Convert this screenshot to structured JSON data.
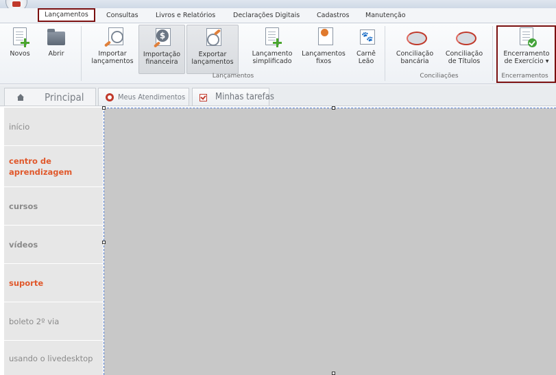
{
  "menu": {
    "tabs": [
      "Lançamentos",
      "Consultas",
      "Livros e Relatórios",
      "Declarações Digitais",
      "Cadastros",
      "Manutenção"
    ],
    "active": "Lançamentos"
  },
  "ribbon": {
    "buttons": [
      {
        "label1": "Novos",
        "label2": ""
      },
      {
        "label1": "Abrir",
        "label2": ""
      },
      {
        "label1": "Importar",
        "label2": "lançamentos"
      },
      {
        "label1": "Importação",
        "label2": "financeira"
      },
      {
        "label1": "Exportar",
        "label2": "lançamentos"
      },
      {
        "label1": "Lançamento",
        "label2": "simplificado"
      },
      {
        "label1": "Lançamentos",
        "label2": "fixos"
      },
      {
        "label1": "Carnê",
        "label2": "Leão"
      },
      {
        "label1": "Conciliação",
        "label2": "bancária"
      },
      {
        "label1": "Conciliação",
        "label2": "de Títulos"
      },
      {
        "label1": "Encerramento",
        "label2": "de Exercício ▾"
      }
    ],
    "groups": [
      "Lançamentos",
      "Conciliações",
      "Encerramentos"
    ]
  },
  "doctabs": {
    "home": "Principal",
    "atendimentos": "Meus Atendimentos",
    "tarefas": "Minhas tarefas"
  },
  "sidebar": {
    "items": [
      {
        "label": "início"
      },
      {
        "label": "centro de aprendizagem"
      },
      {
        "label": "cursos"
      },
      {
        "label": "vídeos"
      },
      {
        "label": "suporte"
      },
      {
        "label": "boleto 2º via"
      },
      {
        "label": "usando o livedesktop"
      }
    ]
  },
  "colors": {
    "accent_orange": "#e0582b",
    "active_border": "#7a0f0f",
    "content_bg": "#c8c8c8"
  }
}
